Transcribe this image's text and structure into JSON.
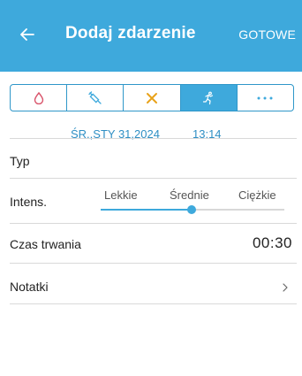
{
  "header": {
    "title": "Dodaj zdarzenie",
    "done_label": "GOTOWE",
    "back_icon": "arrow-left-icon"
  },
  "tabs": [
    {
      "icon": "blood-drop-icon",
      "active": false
    },
    {
      "icon": "syringe-icon",
      "active": false
    },
    {
      "icon": "fork-knife-icon",
      "active": false
    },
    {
      "icon": "running-person-icon",
      "active": true
    },
    {
      "icon": "more-dots-icon",
      "active": false
    }
  ],
  "event": {
    "date": "ŚR.,STY 31,2024",
    "time": "13:14"
  },
  "type_row": {
    "label": "Typ"
  },
  "intensity": {
    "label": "Intens.",
    "options": [
      "Lekkie",
      "Średnie",
      "Ciężkie"
    ],
    "selected": "Średnie"
  },
  "duration": {
    "label": "Czas trwania",
    "value": "00:30"
  },
  "notes": {
    "label": "Notatki"
  },
  "colors": {
    "accent": "#3ea9dc",
    "drop": "#d9546b",
    "cutlery": "#e8a21a",
    "text": "#222222"
  }
}
